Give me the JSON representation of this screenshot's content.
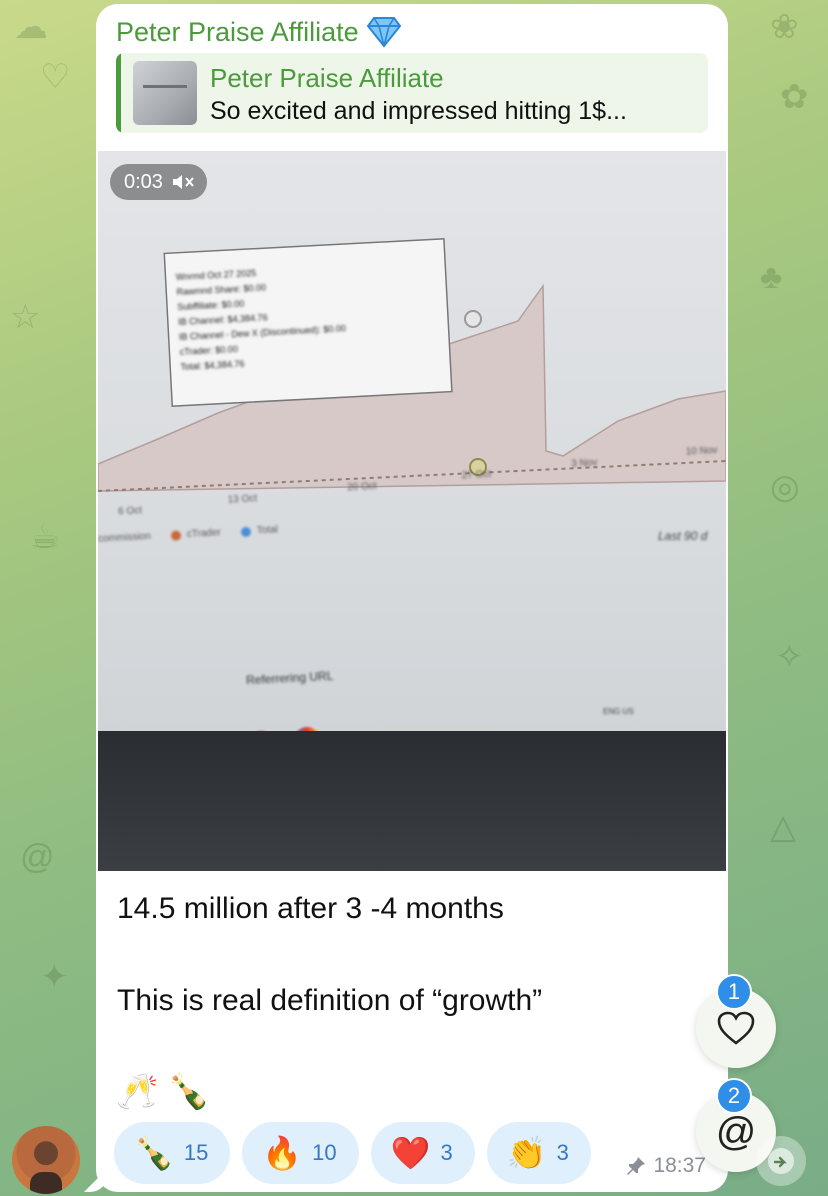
{
  "message": {
    "sender": "Peter Praise Affiliate",
    "reply": {
      "name": "Peter Praise Affiliate",
      "text": "So excited and impressed hitting 1$..."
    },
    "video": {
      "duration": "0:03",
      "tooltip": {
        "lines": [
          "Wnrmd Oct 27 2025",
          "Rawmnd Share: $0.00",
          "Subffiliate: $0.00",
          "IB Channel: $4,384.76",
          "IB Channel - Dew X (Discontinued): $0.00",
          "cTrader: $0.00",
          "Total: $4,384.76"
        ]
      },
      "x_ticks": [
        "6 Oct",
        "13 Oct",
        "20 Oct",
        "27 Oct",
        "3 Nov",
        "10 Nov"
      ],
      "legend": [
        "commission",
        "cTrader",
        "Total"
      ],
      "right_label": "Last 90 d",
      "url_label": "Referrering URL",
      "tray": "ENG US"
    },
    "text_line1": "14.5 million after 3 -4 months",
    "text_line2": "This is real definition of “growth”",
    "emojis": "🥂 🍾",
    "reactions": [
      {
        "emoji": "🍾",
        "count": "15"
      },
      {
        "emoji": "🔥",
        "count": "10"
      },
      {
        "emoji": "❤️",
        "count": "3"
      },
      {
        "emoji": "👏",
        "count": "3"
      }
    ],
    "time": "18:37"
  },
  "floating": {
    "reactions_badge": "1",
    "mentions_badge": "2"
  },
  "colors": {
    "sender_green": "#4b9b3c",
    "reaction_bg": "#dfeffb",
    "count_blue": "#3478c6",
    "badge_blue": "#2f8ee8"
  }
}
